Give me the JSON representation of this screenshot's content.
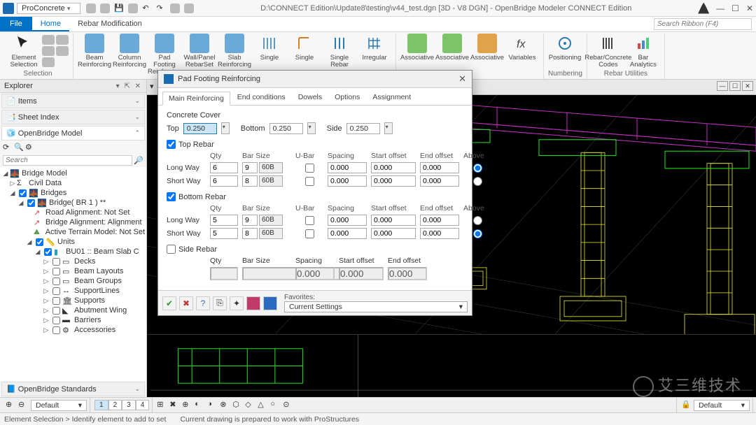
{
  "titlebar": {
    "dropdown": "ProConcrete",
    "title": "D:\\CONNECT Edition\\Update8\\testing\\v44_test.dgn [3D - V8 DGN] - OpenBridge Modeler CONNECT Edition"
  },
  "ribbon": {
    "file": "File",
    "tabs": [
      "Home",
      "Rebar Modification"
    ],
    "active_tab": "Home",
    "search_placeholder": "Search Ribbon (F4)",
    "groups": {
      "selection": {
        "label": "Selection",
        "element_selection": "Element\nSelection"
      },
      "reinforcing": {
        "label": "Reinforcing",
        "beam": "Beam\nReinforcing",
        "column": "Column\nReinforcing",
        "pad": "Pad Footing\nReinforcing",
        "wall": "Wall/Panel\nRebarSet",
        "slab": "Slab\nReinforcing",
        "single1": "Single",
        "single2": "Single",
        "single_rebar": "Single Rebar",
        "irregular": "Irregular"
      },
      "associative": {
        "a1": "Associative",
        "a2": "Associative",
        "a3": "Associative"
      },
      "variables": "Variables",
      "numbering": {
        "label": "Numbering",
        "pos": "Positioning"
      },
      "utilities": {
        "label": "Rebar Utilities",
        "codes": "Rebar/Concrete\nCodes",
        "bar": "Bar\nAnalytics"
      }
    }
  },
  "explorer": {
    "title": "Explorer",
    "items_hdr": "Items",
    "sheet_hdr": "Sheet Index",
    "model_hdr": "OpenBridge Model",
    "search_placeholder": "Search",
    "standards_hdr": "OpenBridge Standards",
    "tree": {
      "root": "Bridge Model",
      "civil": "Civil Data",
      "bridges": "Bridges",
      "bridge1": "Bridge( BR 1 ) **",
      "road_align": "Road Alignment: Not Set",
      "bridge_align": "Bridge Alignment: Alignment",
      "terrain": "Active Terrain Model: Not Set",
      "units": "Units",
      "bu01": "BU01 :: Beam Slab C",
      "decks": "Decks",
      "beam_layouts": "Beam Layouts",
      "beam_groups": "Beam Groups",
      "support_lines": "SupportLines",
      "supports": "Supports",
      "abutment": "Abutment Wing",
      "barriers": "Barriers",
      "accessories": "Accessories"
    }
  },
  "dialog": {
    "title": "Pad Footing Reinforcing",
    "tabs": [
      "Main Reinforcing",
      "End conditions",
      "Dowels",
      "Options",
      "Assignment"
    ],
    "active_tab": "Main Reinforcing",
    "concrete_cover": {
      "label": "Concrete Cover",
      "top_lbl": "Top",
      "top_val": "0.250",
      "bottom_lbl": "Bottom",
      "bottom_val": "0.250",
      "side_lbl": "Side",
      "side_val": "0.250"
    },
    "top_rebar": {
      "label": "Top Rebar",
      "hdr": {
        "qty": "Qty",
        "bar": "Bar Size",
        "ubar": "U-Bar",
        "spacing": "Spacing",
        "start": "Start offset",
        "end": "End offset",
        "above": "Above"
      },
      "long_lbl": "Long Way",
      "long_qty": "6",
      "long_bar": "9",
      "long_grade": "60B",
      "long_sp": "0.000",
      "long_so": "0.000",
      "long_eo": "0.000",
      "short_lbl": "Short Way",
      "short_qty": "6",
      "short_bar": "8",
      "short_grade": "60B",
      "short_sp": "0.000",
      "short_so": "0.000",
      "short_eo": "0.000"
    },
    "bottom_rebar": {
      "label": "Bottom Rebar",
      "long_lbl": "Long Way",
      "long_qty": "5",
      "long_bar": "9",
      "long_grade": "60B",
      "long_sp": "0.000",
      "long_so": "0.000",
      "long_eo": "0.000",
      "short_lbl": "Short Way",
      "short_qty": "5",
      "short_bar": "8",
      "short_grade": "60B",
      "short_sp": "0.000",
      "short_so": "0.000",
      "short_eo": "0.000"
    },
    "side_rebar": {
      "label": "Side Rebar",
      "hdr": {
        "qty": "Qty",
        "bar": "Bar Size",
        "spacing": "Spacing",
        "start": "Start offset",
        "end": "End offset"
      },
      "qty": "",
      "sp": "0.000",
      "so": "0.000",
      "eo": "0.000"
    },
    "favorites_lbl": "Favorites:",
    "favorites_val": "Current Settings"
  },
  "lowbar": {
    "default1": "Default",
    "tabs": [
      "1",
      "2",
      "3",
      "4"
    ],
    "default2": "Default"
  },
  "status": {
    "left": "Element Selection > Identify element to add to set",
    "mid": "Current drawing is prepared to work with ProStructures"
  },
  "watermark": "艾三维技术"
}
